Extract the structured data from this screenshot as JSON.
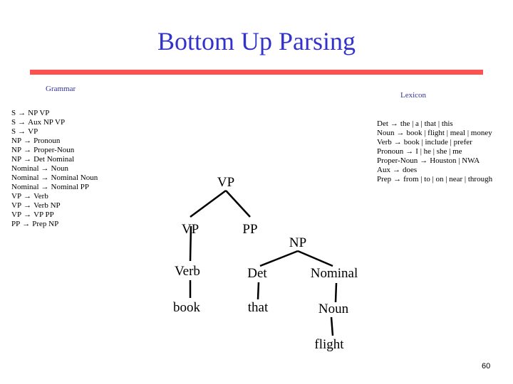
{
  "slide": {
    "title": "Bottom Up Parsing",
    "page_number": "60",
    "accent_rule_color": "#ff5050",
    "title_color": "#3333cc"
  },
  "grammar": {
    "label": "Grammar",
    "rules": [
      {
        "lhs": "S",
        "rhs": "NP VP"
      },
      {
        "lhs": "S",
        "rhs": "Aux NP VP"
      },
      {
        "lhs": "S",
        "rhs": "VP"
      },
      {
        "lhs": "NP",
        "rhs": "Pronoun"
      },
      {
        "lhs": "NP",
        "rhs": "Proper-Noun"
      },
      {
        "lhs": "NP",
        "rhs": "Det Nominal"
      },
      {
        "lhs": "Nominal",
        "rhs": "Noun"
      },
      {
        "lhs": "Nominal",
        "rhs": "Nominal Noun"
      },
      {
        "lhs": "Nominal",
        "rhs": "Nominal PP"
      },
      {
        "lhs": "VP",
        "rhs": "Verb"
      },
      {
        "lhs": "VP",
        "rhs": "Verb NP"
      },
      {
        "lhs": "VP",
        "rhs": "VP PP"
      },
      {
        "lhs": "PP",
        "rhs": "Prep NP"
      }
    ]
  },
  "lexicon": {
    "label": "Lexicon",
    "rules": [
      {
        "lhs": "Det",
        "rhs": "the | a | that | this"
      },
      {
        "lhs": "Noun",
        "rhs": "book | flight | meal | money"
      },
      {
        "lhs": "Verb",
        "rhs": "book | include | prefer"
      },
      {
        "lhs": "Pronoun",
        "rhs": "I | he | she | me"
      },
      {
        "lhs": "Proper-Noun",
        "rhs": "Houston | NWA"
      },
      {
        "lhs": "Aux",
        "rhs": "does"
      },
      {
        "lhs": "Prep",
        "rhs": "from | to | on | near | through"
      }
    ]
  },
  "arrow_symbol": "→",
  "tree": {
    "nodes": {
      "vp_top": "VP",
      "vp_left": "VP",
      "pp": "PP",
      "np": "NP",
      "verb": "Verb",
      "det": "Det",
      "nominal": "Nominal",
      "book": "book",
      "that": "that",
      "noun": "Noun",
      "flight": "flight"
    },
    "edges": [
      [
        "vp_top",
        "vp_left"
      ],
      [
        "vp_top",
        "pp"
      ],
      [
        "vp_left",
        "verb"
      ],
      [
        "verb",
        "book"
      ],
      [
        "np",
        "det"
      ],
      [
        "np",
        "nominal"
      ],
      [
        "det",
        "that"
      ],
      [
        "nominal",
        "noun"
      ],
      [
        "noun",
        "flight"
      ]
    ]
  }
}
